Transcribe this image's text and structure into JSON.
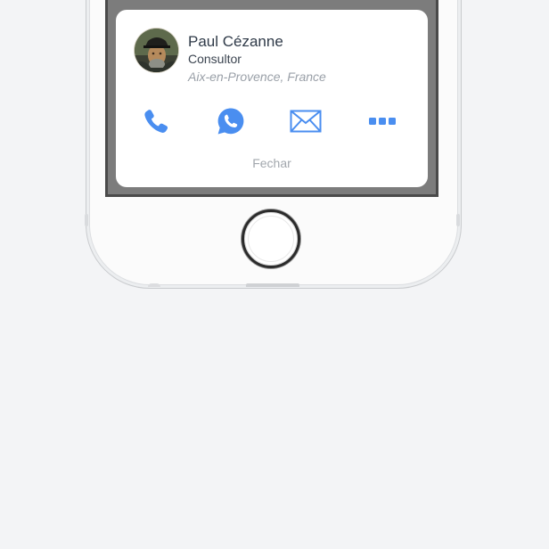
{
  "contact": {
    "name": "Paul Cézanne",
    "role": "Consultor",
    "location": "Aix-en-Provence, France",
    "avatar_icon": "portrait-avatar"
  },
  "actions": [
    {
      "name": "call",
      "icon": "phone-icon"
    },
    {
      "name": "whatsapp",
      "icon": "whatsapp-icon"
    },
    {
      "name": "email",
      "icon": "mail-icon"
    },
    {
      "name": "more",
      "icon": "more-dots-icon"
    }
  ],
  "close_label": "Fechar",
  "colors": {
    "accent": "#4a8ef0",
    "background": "#f3f4f6",
    "card": "#ffffff",
    "screen_dim": "#7c7c7c"
  }
}
